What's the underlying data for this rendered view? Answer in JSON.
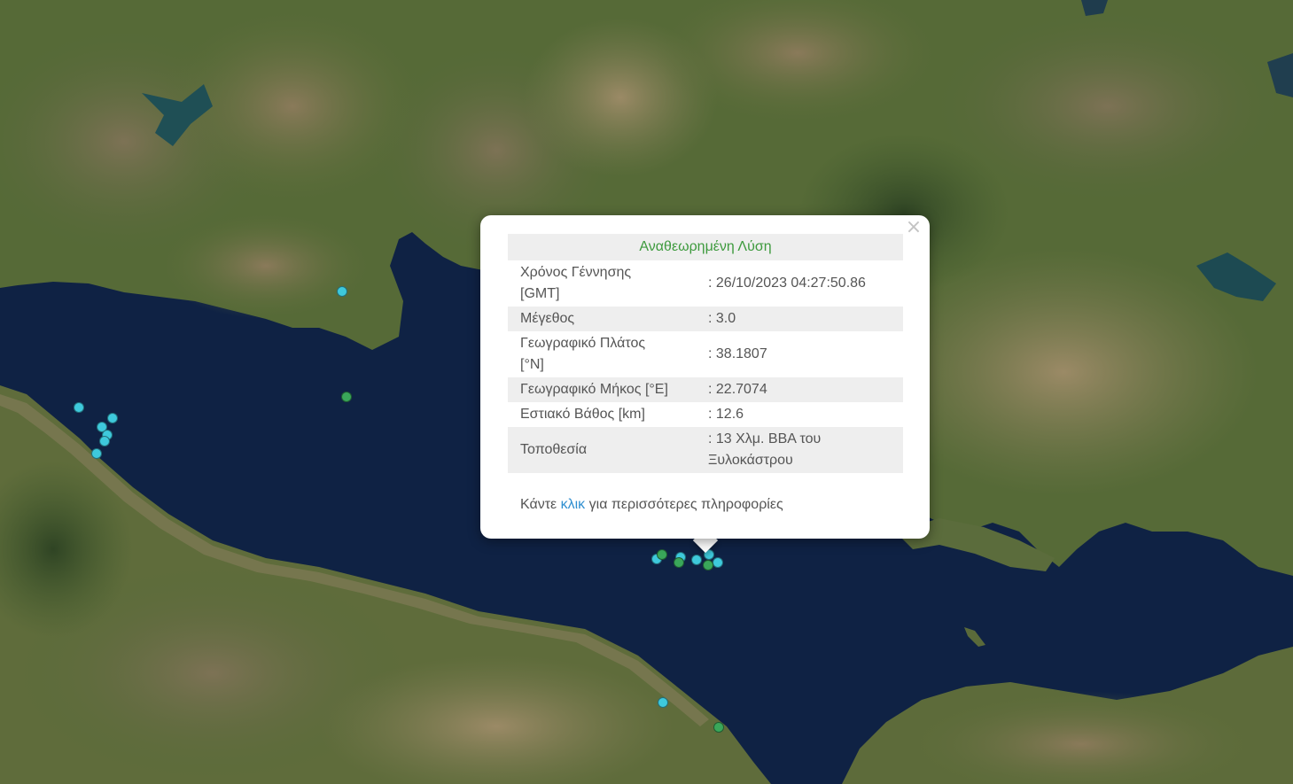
{
  "popup": {
    "header": "Αναθεωρημένη Λύση",
    "close_symbol": "×",
    "rows": [
      {
        "label": "Χρόνος Γέννησης [GMT]",
        "value": ": 26/10/2023 04:27:50.86"
      },
      {
        "label": "Μέγεθος",
        "value": ": 3.0"
      },
      {
        "label": "Γεωγραφικό Πλάτος [°N]",
        "value": ": 38.1807"
      },
      {
        "label": "Γεωγραφικό Μήκος [°E]",
        "value": ": 22.7074"
      },
      {
        "label": "Εστιακό Βάθος [km]",
        "value": ": 12.6"
      },
      {
        "label": "Τοποθεσία",
        "value": ": 13 Χλμ. ΒΒΑ του Ξυλοκάστρου"
      }
    ],
    "more_prefix": "Κάντε ",
    "more_link": "κλικ",
    "more_suffix": " για περισσότερες πληροφορίες"
  },
  "colors": {
    "sea": "#0f2244",
    "land": "#5c6d3a",
    "mountain": "#6b6448",
    "marker_cyan": "#3ec9dc",
    "marker_green": "#3aa75a",
    "header_green": "#3d9a3d",
    "link_blue": "#2f8fd0"
  }
}
